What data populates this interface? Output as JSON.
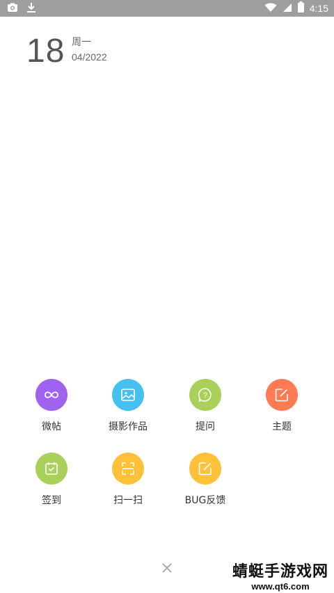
{
  "status_bar": {
    "time": "4:15",
    "icons": [
      "camera-icon",
      "download-icon",
      "wifi-icon",
      "signal-icon",
      "battery-icon"
    ]
  },
  "date": {
    "day": "18",
    "weekday": "周一",
    "month_year": "04/2022"
  },
  "actions": [
    {
      "label": "微帖",
      "icon": "infinity-icon",
      "color": "#a062f0"
    },
    {
      "label": "摄影作品",
      "icon": "image-icon",
      "color": "#46c1ef"
    },
    {
      "label": "提问",
      "icon": "question-bubble-icon",
      "color": "#a8d05a"
    },
    {
      "label": "主题",
      "icon": "edit-icon",
      "color": "#ff7b54"
    },
    {
      "label": "签到",
      "icon": "calendar-check-icon",
      "color": "#a8d05a"
    },
    {
      "label": "扫一扫",
      "icon": "scan-icon",
      "color": "#ffc03a"
    },
    {
      "label": "BUG反馈",
      "icon": "edit-icon",
      "color": "#ffc03a"
    }
  ],
  "close": {
    "icon": "close-icon"
  },
  "watermark": {
    "title": "蜻蜓手游戏网",
    "url": "www.qt6.com"
  }
}
